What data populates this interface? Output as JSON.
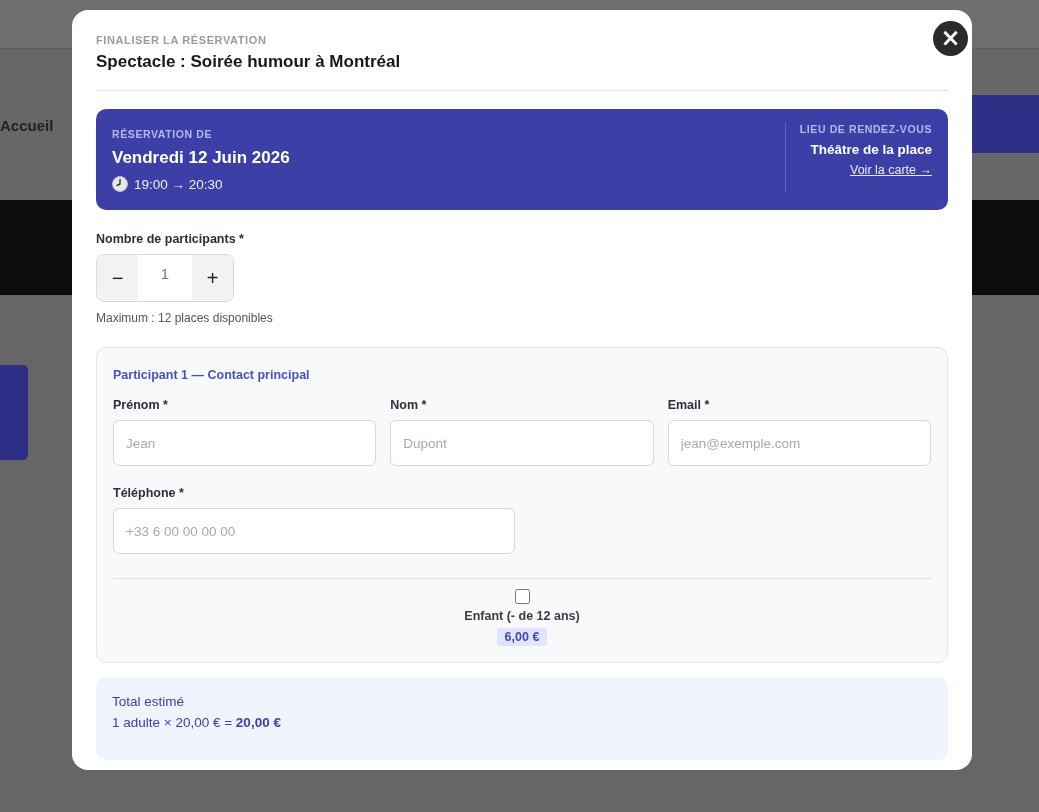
{
  "background": {
    "heading": "Accueil"
  },
  "dialog": {
    "eyebrow": "FINALISER LA RÉSERVATION",
    "title": "Spectacle : Soirée humour à Montréal",
    "close": "×"
  },
  "booking": {
    "label": "RÉSERVATION DE",
    "date": "Vendredi 12 Juin 2026",
    "time": "19:00 → 20:30",
    "venue_label": "LIEU DE RENDEZ-VOUS",
    "venue": "Théâtre de la place",
    "map_link": "Voir la carte →"
  },
  "participants": {
    "label": "Nombre de participants *",
    "decrement": "−",
    "value": "1",
    "increment": "+",
    "hint": "Maximum : 12 places disponibles"
  },
  "participant_cards": [
    {
      "title": "Participant 1 — Contact principal",
      "fields": [
        {
          "label": "Prénom *",
          "placeholder": "Jean"
        },
        {
          "label": "Nom *",
          "placeholder": "Dupont"
        },
        {
          "label": "Email *",
          "placeholder": "jean@exemple.com"
        },
        {
          "label": "Téléphone *",
          "placeholder": "+33 6 00 00 00 00"
        }
      ],
      "child": {
        "label": "Enfant (- de 12 ans)",
        "checked": false,
        "price": "6,00 €"
      }
    }
  ],
  "total": {
    "label": "Total estimé",
    "line": "1 adulte × 20,00 € = **20,00 €**"
  }
}
